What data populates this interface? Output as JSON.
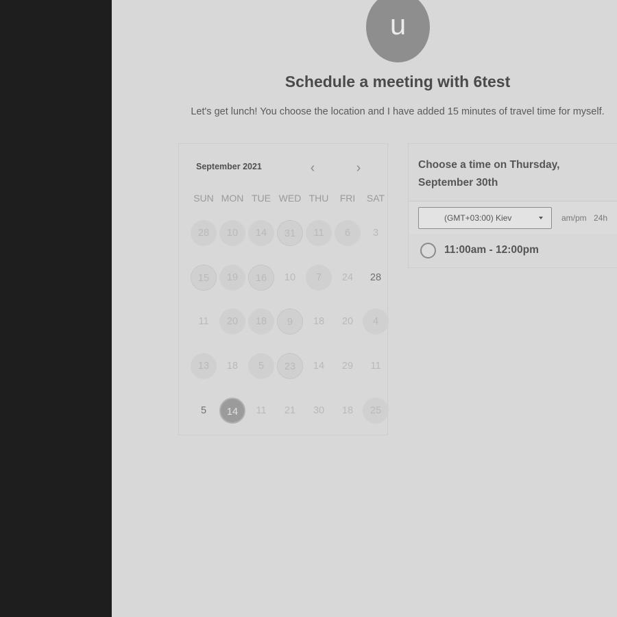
{
  "header": {
    "avatar_letter": "u",
    "title": "Schedule a meeting with 6test",
    "subtitle": "Let's get lunch! You choose the location and I have added 15 minutes of travel time for myself."
  },
  "calendar": {
    "month_label": "September 2021",
    "prev_icon": "chevron-left-icon",
    "next_icon": "chevron-right-icon",
    "prev_glyph": "‹",
    "next_glyph": "›",
    "weekdays": [
      "SUN",
      "MON",
      "TUE",
      "WED",
      "THU",
      "FRI",
      "SAT"
    ],
    "weeks": [
      [
        {
          "t": "28",
          "s": "avail"
        },
        {
          "t": "10",
          "s": "avail"
        },
        {
          "t": "14",
          "s": "avail"
        },
        {
          "t": "31",
          "s": "dotted"
        },
        {
          "t": "11",
          "s": "avail"
        },
        {
          "t": "6",
          "s": "avail"
        },
        {
          "t": "3",
          "s": "plain"
        }
      ],
      [
        {
          "t": "15",
          "s": "dotted"
        },
        {
          "t": "19",
          "s": "avail"
        },
        {
          "t": "16",
          "s": "dotted"
        },
        {
          "t": "10",
          "s": "plain"
        },
        {
          "t": "7",
          "s": "avail"
        },
        {
          "t": "24",
          "s": "plain"
        },
        {
          "t": "28",
          "s": "bold"
        }
      ],
      [
        {
          "t": "11",
          "s": "plain"
        },
        {
          "t": "20",
          "s": "avail"
        },
        {
          "t": "18",
          "s": "avail"
        },
        {
          "t": "9",
          "s": "dotted"
        },
        {
          "t": "18",
          "s": "plain"
        },
        {
          "t": "20",
          "s": "plain"
        },
        {
          "t": "4",
          "s": "avail"
        }
      ],
      [
        {
          "t": "13",
          "s": "avail"
        },
        {
          "t": "18",
          "s": "plain"
        },
        {
          "t": "5",
          "s": "avail"
        },
        {
          "t": "23",
          "s": "dotted"
        },
        {
          "t": "14",
          "s": "plain"
        },
        {
          "t": "29",
          "s": "plain"
        },
        {
          "t": "11",
          "s": "plain"
        }
      ],
      [
        {
          "t": "5",
          "s": "bold"
        },
        {
          "t": "14",
          "s": "selected"
        },
        {
          "t": "11",
          "s": "plain"
        },
        {
          "t": "21",
          "s": "plain"
        },
        {
          "t": "30",
          "s": "plain"
        },
        {
          "t": "18",
          "s": "plain"
        },
        {
          "t": "25",
          "s": "avail"
        }
      ]
    ]
  },
  "times": {
    "heading_line1": "Choose a time on Thursday,",
    "heading_line2": "September 30th",
    "timezone_value": "(GMT+03:00) Kiev",
    "format_ampm": "am/pm",
    "format_24h": "24h",
    "slots": [
      {
        "label": "11:00am - 12:00pm"
      }
    ]
  }
}
